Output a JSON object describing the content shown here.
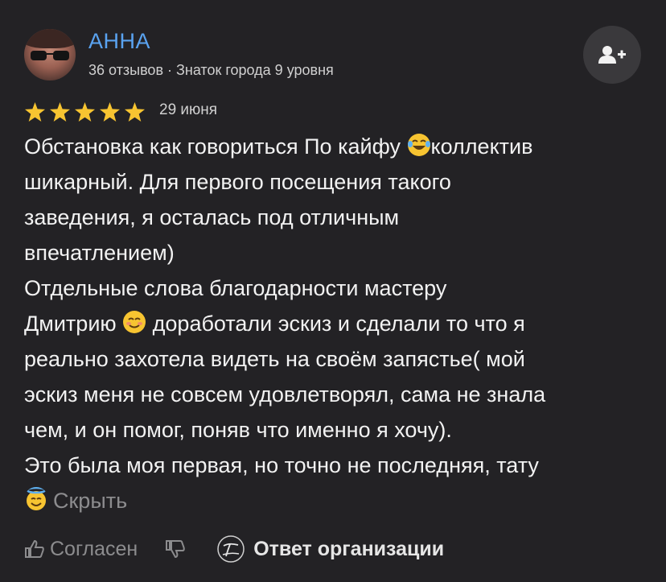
{
  "user": {
    "name": "АННА",
    "meta": "36 отзывов · Знаток города 9 уровня"
  },
  "follow": {
    "icon": "add-user-icon"
  },
  "rating": {
    "stars": 5,
    "max": 5,
    "color": "#f7c431"
  },
  "date": "29 июня",
  "review": {
    "l1a": "Обстановка как говориться По кайфу ",
    "l1b": "коллектив",
    "l2": "шикарный. Для первого посещения такого",
    "l3": "заведения, я осталась под отличным",
    "l4": "впечатлением)",
    "l5": "Отдельные слова благодарности мастеру",
    "l6a": "Дмитрию ",
    "l6b": " доработали эскиз и сделали то что я",
    "l7": "реально захотела видеть на своём запястье( мой",
    "l8": "эскиз меня не совсем удовлетворял, сама не знала",
    "l9": "чем, и он помог, поняв что именно я хочу).",
    "l10": "Это была моя первая, но точно не последняя, тату",
    "hide": "Скрыть"
  },
  "actions": {
    "agree": "Согласен",
    "org_reply": "Ответ организации"
  },
  "colors": {
    "background": "#232225",
    "accent_name": "#5aa3f0",
    "muted": "#8c8c8e"
  }
}
